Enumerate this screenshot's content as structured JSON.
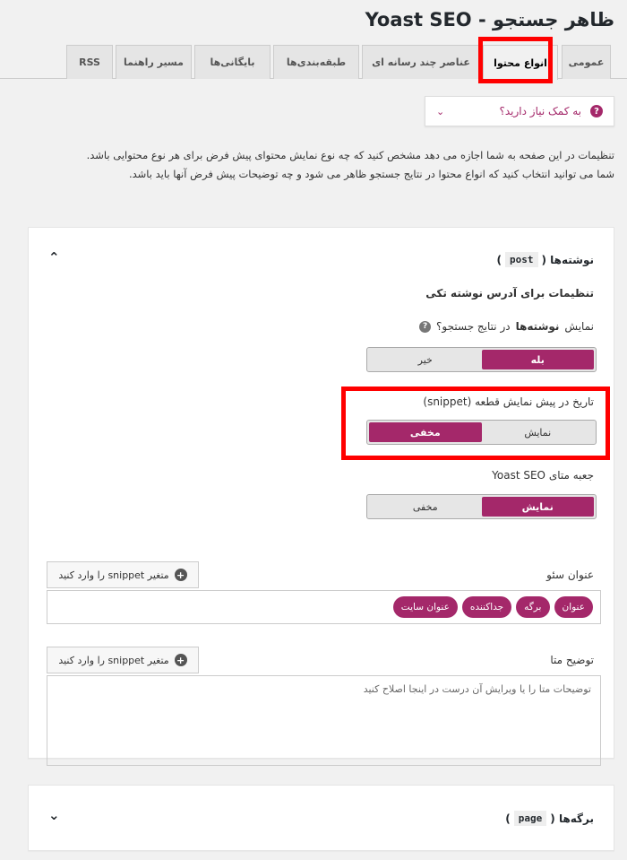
{
  "header": {
    "title": "ظاهر جستجو - Yoast SEO"
  },
  "tabs": [
    {
      "label": "عمومی"
    },
    {
      "label": "انواع محتوا"
    },
    {
      "label": "عناصر چند رسانه ای"
    },
    {
      "label": "طبقه‌بندی‌ها"
    },
    {
      "label": "بایگانی‌ها"
    },
    {
      "label": "مسیر راهنما"
    },
    {
      "label": "RSS"
    }
  ],
  "help": {
    "label": "به کمک نیاز دارید؟",
    "icon": "question-icon",
    "chevron": "chevron-down-icon"
  },
  "intro": "تنظیمات در این صفحه به شما اجازه می دهد مشخص کنید که چه نوع نمایش محتوای پیش فرض برای هر نوع محتوایی باشد. شما می توانید انتخاب کنید که انواع محتوا در نتایج جستجو ظاهر می شود و چه توضیحات پیش فرض آنها باید باشد.",
  "post_section": {
    "title": "نوشته‌ها (",
    "code": "post",
    "title_end": ")",
    "subheading": "تنظیمات برای آدرس نوشته تکی",
    "show_label_pre": "نمایش",
    "show_label_bold": "نوشته‌ها",
    "show_label_post": "در نتایج جستجو؟",
    "show_toggle": {
      "on": "بله",
      "off": "خیر",
      "selected": "بله"
    },
    "date_label": "تاریخ در پیش نمایش قطعه (snippet)",
    "date_toggle": {
      "show": "نمایش",
      "hide": "مخفی",
      "selected": "مخفی"
    },
    "metabox_label": "جعبه متای Yoast SEO",
    "metabox_toggle": {
      "show": "نمایش",
      "hide": "مخفی",
      "selected": "نمایش"
    },
    "seo_title_label": "عنوان سئو",
    "insert_snippet": "متغیر snippet را وارد کنید",
    "seo_title_pills": [
      "عنوان",
      "برگه",
      "جداکننده",
      "عنوان سایت"
    ],
    "meta_desc_label": "توضیح متا",
    "meta_desc_placeholder": "توضیحات متا را یا ویرایش آن درست در اینجا اصلاح کنید"
  },
  "page_section": {
    "title": "برگه‌ها (",
    "code": "page",
    "title_end": ")"
  },
  "colors": {
    "accent": "#a4286a",
    "highlight": "#ff0000"
  }
}
